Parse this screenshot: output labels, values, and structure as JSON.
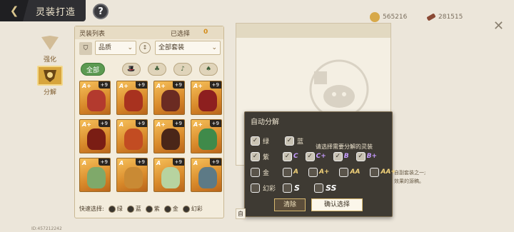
{
  "header": {
    "title": "灵装打造",
    "help_label": "?",
    "close_label": "✕"
  },
  "currency": [
    {
      "value": "565216",
      "color": "#d7a94a",
      "icon": "coin-icon"
    },
    {
      "value": "281515",
      "color": "#8a4a35",
      "icon": "scroll-icon"
    }
  ],
  "sidenav": {
    "items": [
      {
        "label": "强化",
        "icon": "enhance-emblem-icon",
        "active": false
      },
      {
        "label": "分解",
        "icon": "decompose-emblem-icon",
        "active": true
      }
    ]
  },
  "list_panel": {
    "title": "灵装列表",
    "selected_label": "已选择",
    "selected_count": "0",
    "filter_quality": "品质",
    "filter_suit": "全部套装",
    "suit_tabs": [
      "全部",
      "",
      "",
      "",
      "",
      ""
    ],
    "cards": [
      {
        "grade": "A+",
        "level": "+9",
        "art": "#b33a2e"
      },
      {
        "grade": "A+",
        "level": "+9",
        "art": "#a8321f"
      },
      {
        "grade": "A+",
        "level": "+9",
        "art": "#6b2b22"
      },
      {
        "grade": "A+",
        "level": "+9",
        "art": "#8d1f1f"
      },
      {
        "grade": "A+",
        "level": "+9",
        "art": "#7a1d14"
      },
      {
        "grade": "A",
        "level": "+9",
        "art": "#c24c22"
      },
      {
        "grade": "A+",
        "level": "+9",
        "art": "#4a2618"
      },
      {
        "grade": "A+",
        "level": "+9",
        "art": "#3f8a4a"
      },
      {
        "grade": "A",
        "level": "+9",
        "art": "#7fa96a"
      },
      {
        "grade": "A",
        "level": "+9",
        "art": "#c98a34"
      },
      {
        "grade": "A",
        "level": "+9",
        "art": "#b7d3a0"
      },
      {
        "grade": "A",
        "level": "+9",
        "art": "#5d7a86"
      }
    ],
    "quick_label": "快速选择:",
    "quick_options": [
      "绿",
      "蓝",
      "紫",
      "金",
      "幻彩"
    ]
  },
  "popup": {
    "title": "自动分解",
    "rows": [
      {
        "label": "绿",
        "checked": true,
        "extra_label": "蓝",
        "extra_checked": true,
        "grades": []
      },
      {
        "label": "紫",
        "checked": true,
        "grades": [
          "C",
          "C+",
          "B",
          "B+"
        ],
        "grade_color": "purple",
        "grades_checked": true
      },
      {
        "label": "金",
        "checked": false,
        "grades": [
          "A",
          "A+",
          "AA",
          "AA+"
        ],
        "grade_color": "gold",
        "grades_checked": false
      },
      {
        "label": "幻彩",
        "checked": false,
        "grades": [
          "S",
          "SS"
        ],
        "grade_color": "white",
        "grades_checked": false
      }
    ],
    "hint": "请选择需要分解的灵装",
    "clear_label": "清除",
    "confirm_label": "确认选择"
  },
  "side_note": {
    "line1": "自副套装之一;",
    "line2": "效果的源稿。"
  },
  "auto_left_label": "自",
  "user_id": "ID:457212242"
}
